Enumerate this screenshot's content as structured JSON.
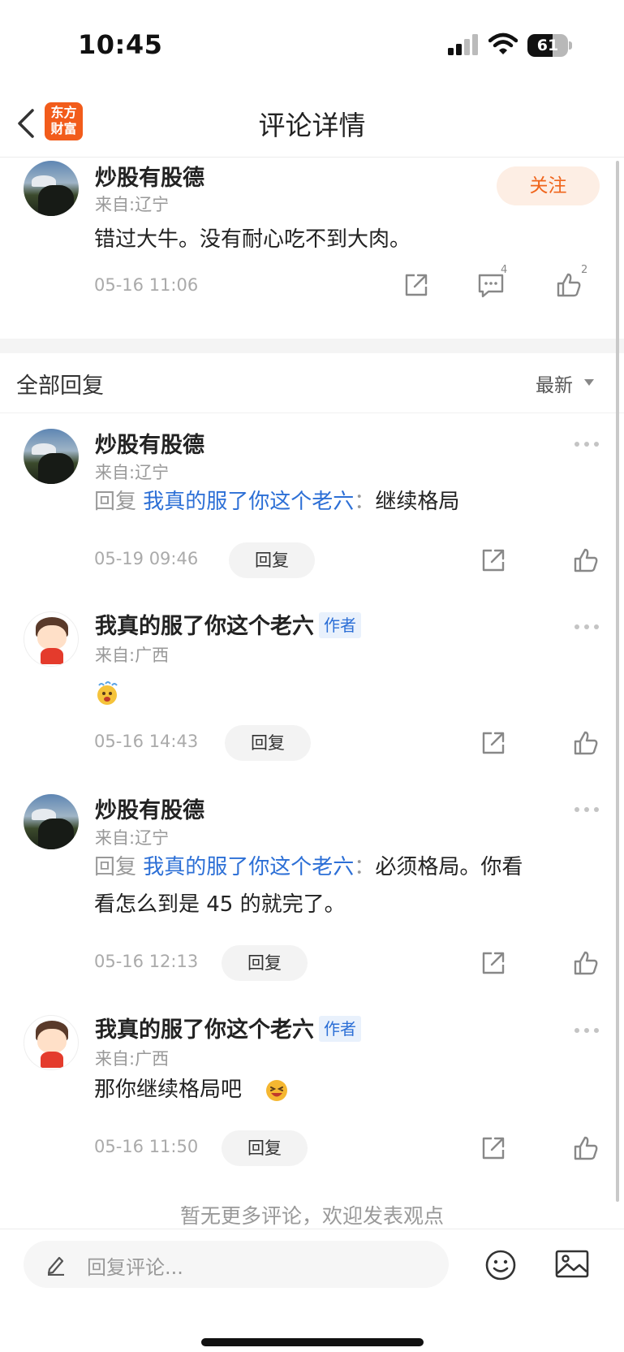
{
  "status_bar": {
    "time": "10:45",
    "battery": "61",
    "battery_level": 0.61
  },
  "nav": {
    "logo_line1": "东方",
    "logo_line2": "财富",
    "title": "评论详情"
  },
  "main_comment": {
    "username": "炒股有股德",
    "from": "来自:辽宁",
    "text": "错过大牛。没有耐心吃不到大肉。",
    "timestamp": "05-16 11:06",
    "follow_label": "关注",
    "comment_count": "4",
    "like_count": "2"
  },
  "all_replies": {
    "label": "全部回复",
    "sort": "最新"
  },
  "replies": [
    {
      "username": "炒股有股德",
      "from": "来自:辽宁",
      "reply_prefix": "回复",
      "reply_to": "我真的服了你这个老六",
      "colon": "：",
      "text": "继续格局",
      "timestamp": "05-19 09:46",
      "reply_label": "回复"
    },
    {
      "username": "我真的服了你这个老六",
      "author_tag": "作者",
      "from": "来自:广西",
      "timestamp": "05-16 14:43",
      "reply_label": "回复"
    },
    {
      "username": "炒股有股德",
      "from": "来自:辽宁",
      "reply_prefix": "回复",
      "reply_to": "我真的服了你这个老六",
      "colon": "：",
      "text": "必须格局。你看",
      "text_line2": "看怎么到是 45 的就完了。",
      "timestamp": "05-16 12:13",
      "reply_label": "回复"
    },
    {
      "username": "我真的服了你这个老六",
      "author_tag": "作者",
      "from": "来自:广西",
      "text": "那你继续格局吧",
      "timestamp": "05-16 11:50",
      "reply_label": "回复"
    }
  ],
  "footer": {
    "no_more": "暂无更多评论，欢迎发表观点"
  },
  "bottom_bar": {
    "placeholder": "回复评论..."
  },
  "colors": {
    "accent": "#f0651c",
    "link": "#2c6fd6",
    "logo_bg": "#f25c1b"
  }
}
